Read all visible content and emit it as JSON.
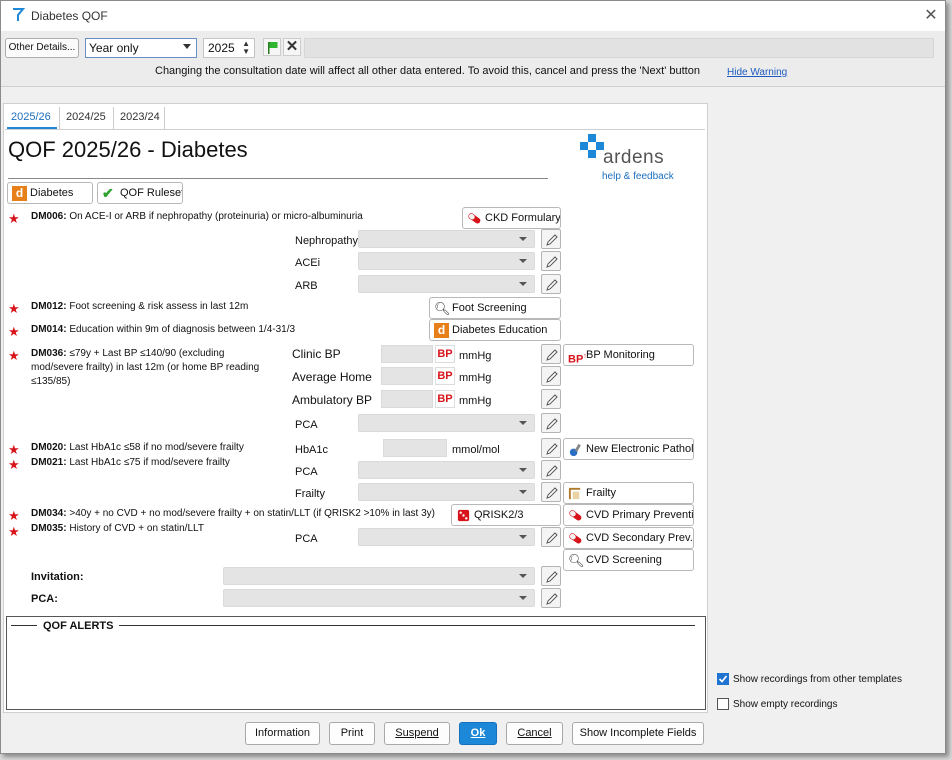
{
  "window": {
    "title": "Diabetes QOF"
  },
  "toolbar": {
    "other_details_label": "Other Details...",
    "period_select": "Year only",
    "year_value": "2025",
    "warning_text": "Changing the consultation date will affect all other data entered. To avoid this, cancel and press the 'Next' button",
    "hide_warning_label": "Hide Warning"
  },
  "tabs": [
    "2025/26",
    "2024/25",
    "2023/24"
  ],
  "page": {
    "heading": "QOF 2025/26 - Diabetes",
    "brand_name": "ardens",
    "brand_link": "help & feedback",
    "diabetes_btn": "Diabetes",
    "ruleset_btn": "QOF Ruleset"
  },
  "rules": {
    "dm006_code": "DM006:",
    "dm006_text": " On ACE-I or ARB if nephropathy (proteinuria) or micro-albuminuria",
    "dm012_code": "DM012:",
    "dm012_text": " Foot screening & risk assess in last 12m",
    "dm014_code": "DM014:",
    "dm014_text": " Education within 9m of diagnosis between 1/4-31/3",
    "dm036_code": "DM036:",
    "dm036_line1": " ≤79y + Last BP ≤140/90 (excluding",
    "dm036_line2": "mod/severe frailty) in last 12m (or home BP reading",
    "dm036_line3": "≤135/85)",
    "dm020_code": "DM020:",
    "dm020_text": " Last HbA1c ≤58 if no mod/severe frailty",
    "dm021_code": "DM021:",
    "dm021_text": " Last HbA1c ≤75 if mod/severe frailty",
    "dm034_code": "DM034:",
    "dm034_text": " >40y + no CVD + no mod/severe frailty + on statin/LLT (if QRISK2 >10% in last 3y)",
    "dm035_code": "DM035:",
    "dm035_text": " History of CVD + on statin/LLT"
  },
  "fields": {
    "nephropathy": "Nephropathy",
    "acei": "ACEi",
    "arb": "ARB",
    "clinic_bp": "Clinic BP",
    "average_home": "Average Home",
    "ambulatory_bp": "Ambulatory BP",
    "bp_badge": "BP",
    "mmhg": "mmHg",
    "pca": "PCA",
    "hba1c": "HbA1c",
    "mmolmol": "mmol/mol",
    "frailty": "Frailty",
    "invitation": "Invitation:",
    "pca_colon": "PCA:"
  },
  "side_buttons": {
    "ckd": "CKD Formulary",
    "foot": "Foot Screening",
    "education": "Diabetes Education",
    "bp_monitoring": "BP Monitoring",
    "pathology": "New Electronic Pathol...",
    "frailty": "Frailty",
    "qrisk": "QRISK2/3",
    "cvd_primary": "CVD Primary Preventi...",
    "cvd_secondary": "CVD Secondary Prev...",
    "cvd_screening": "CVD Screening"
  },
  "alerts": {
    "title": "QOF ALERTS"
  },
  "options": {
    "show_other_templates": "Show recordings from other templates",
    "show_other_templates_checked": true,
    "show_empty": "Show empty recordings",
    "show_empty_checked": false
  },
  "footer": {
    "information": "Information",
    "print": "Print",
    "suspend": "Suspend",
    "ok": "Ok",
    "cancel": "Cancel",
    "show_incomplete": "Show Incomplete Fields"
  },
  "colors": {
    "accent": "#1e88d8",
    "star": "#d8141b",
    "ardens_blue": "#1e88d8",
    "ardens_orange": "#e8801a"
  }
}
